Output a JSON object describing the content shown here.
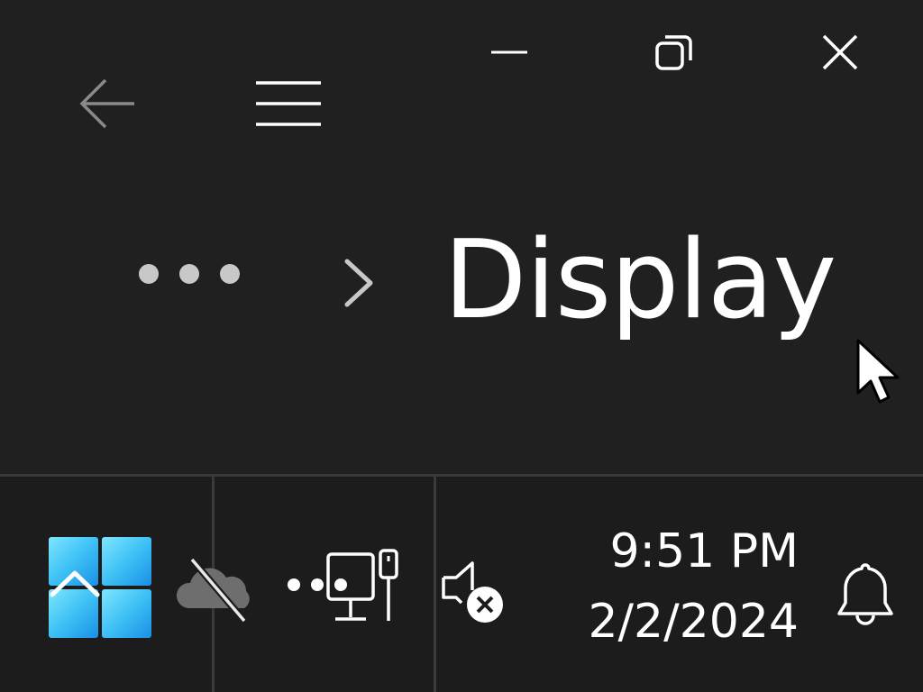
{
  "window": {
    "minimize_icon": "minimize-icon",
    "restore_icon": "restore-icon",
    "close_icon": "close-icon"
  },
  "nav": {
    "back_icon": "arrow-left-icon",
    "menu_icon": "hamburger-menu-icon"
  },
  "breadcrumb": {
    "overflow_icon": "more-horizontal-icon",
    "separator_icon": "chevron-right-icon",
    "current": "Display"
  },
  "taskbar": {
    "start_icon": "windows-start-icon",
    "tray": {
      "onedrive_icon": "onedrive-offline-icon",
      "network_icon": "network-disconnected-icon",
      "volume_icon": "volume-muted-icon"
    },
    "clock": {
      "time": "9:51 PM",
      "date": "2/2/2024"
    },
    "notifications_icon": "bell-icon"
  },
  "colors": {
    "background": "#202020",
    "taskbar": "#1c1c1c",
    "divider": "#3a3a3a",
    "text": "#ffffff",
    "accent_start": "#4cc2ff"
  }
}
